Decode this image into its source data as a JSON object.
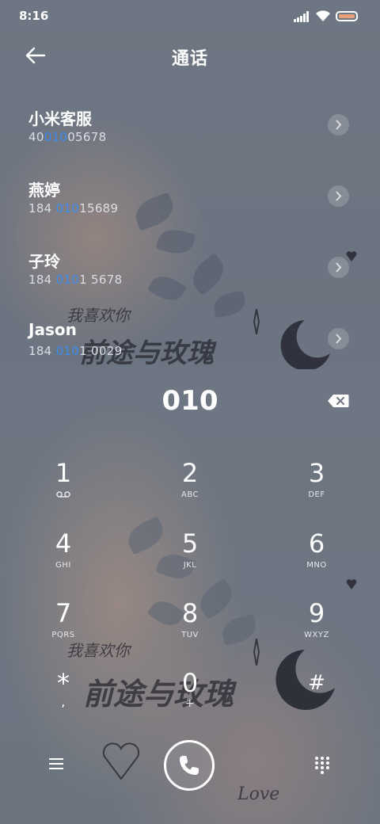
{
  "status": {
    "time": "8:16"
  },
  "header": {
    "title": "通话"
  },
  "contacts": [
    {
      "name": "小米客服",
      "number_pre": "40",
      "number_match": "010",
      "number_post": "05678"
    },
    {
      "name": "燕婷",
      "number_pre": "184 ",
      "number_match": "010",
      "number_post": "15689"
    },
    {
      "name": "子玲",
      "number_pre": "184 ",
      "number_match": "010",
      "number_post": "1 5678"
    },
    {
      "name": "Jason",
      "number_pre": "184 ",
      "number_match": "010",
      "number_post": "1 0029"
    }
  ],
  "dial": {
    "entered": "010"
  },
  "keypad": [
    {
      "digit": "1",
      "letters": ""
    },
    {
      "digit": "2",
      "letters": "ABC"
    },
    {
      "digit": "3",
      "letters": "DEF"
    },
    {
      "digit": "4",
      "letters": "GHI"
    },
    {
      "digit": "5",
      "letters": "JKL"
    },
    {
      "digit": "6",
      "letters": "MNO"
    },
    {
      "digit": "7",
      "letters": "PQRS"
    },
    {
      "digit": "8",
      "letters": "TUV"
    },
    {
      "digit": "9",
      "letters": "WXYZ"
    },
    {
      "digit": "*",
      "letters": ","
    },
    {
      "digit": "0",
      "letters": "+"
    },
    {
      "digit": "#",
      "letters": ""
    }
  ],
  "wallpaper": {
    "text_1": "我喜欢你",
    "text_2": "前途与玫瑰",
    "text_3": "Love"
  },
  "colors": {
    "highlight": "#3b8cf0",
    "battery": "#e8a07a"
  },
  "icons": [
    "back-arrow-icon",
    "chevron-right-icon",
    "backspace-icon",
    "voicemail-icon",
    "menu-icon",
    "phone-icon",
    "dialpad-icon",
    "moon-icon"
  ]
}
